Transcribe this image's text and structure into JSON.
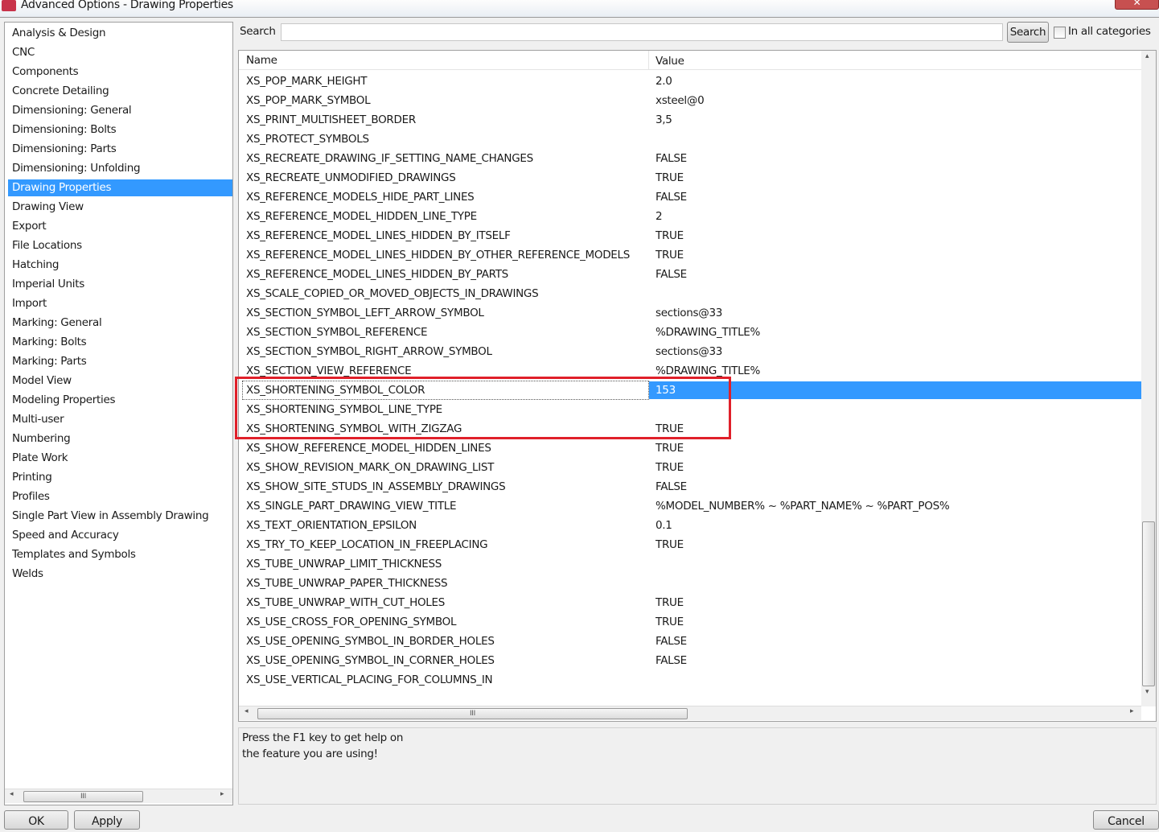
{
  "window": {
    "title": "Advanced Options - Drawing Properties",
    "close": "✕"
  },
  "categories": [
    "Analysis & Design",
    "CNC",
    "Components",
    "Concrete Detailing",
    "Dimensioning: General",
    "Dimensioning: Bolts",
    "Dimensioning: Parts",
    "Dimensioning: Unfolding",
    "Drawing Properties",
    "Drawing View",
    "Export",
    "File Locations",
    "Hatching",
    "Imperial Units",
    "Import",
    "Marking: General",
    "Marking: Bolts",
    "Marking: Parts",
    "Model View",
    "Modeling Properties",
    "Multi-user",
    "Numbering",
    "Plate Work",
    "Printing",
    "Profiles",
    "Single Part View in Assembly Drawing",
    "Speed and Accuracy",
    "Templates and Symbols",
    "Welds"
  ],
  "selected_category": "Drawing Properties",
  "search": {
    "label": "Search",
    "value": "",
    "button": "Search",
    "all_categories_label": "In all categories",
    "all_categories_checked": false
  },
  "table": {
    "headers": {
      "name": "Name",
      "value": "Value"
    },
    "selected_row": "XS_SHORTENING_SYMBOL_COLOR",
    "rows": [
      {
        "name": "XS_POP_MARK_HEIGHT",
        "value": "2.0"
      },
      {
        "name": "XS_POP_MARK_SYMBOL",
        "value": "xsteel@0"
      },
      {
        "name": "XS_PRINT_MULTISHEET_BORDER",
        "value": "3,5"
      },
      {
        "name": "XS_PROTECT_SYMBOLS",
        "value": ""
      },
      {
        "name": "XS_RECREATE_DRAWING_IF_SETTING_NAME_CHANGES",
        "value": "FALSE"
      },
      {
        "name": "XS_RECREATE_UNMODIFIED_DRAWINGS",
        "value": "TRUE"
      },
      {
        "name": "XS_REFERENCE_MODELS_HIDE_PART_LINES",
        "value": "FALSE"
      },
      {
        "name": "XS_REFERENCE_MODEL_HIDDEN_LINE_TYPE",
        "value": "2"
      },
      {
        "name": "XS_REFERENCE_MODEL_LINES_HIDDEN_BY_ITSELF",
        "value": "TRUE"
      },
      {
        "name": "XS_REFERENCE_MODEL_LINES_HIDDEN_BY_OTHER_REFERENCE_MODELS",
        "value": "TRUE"
      },
      {
        "name": "XS_REFERENCE_MODEL_LINES_HIDDEN_BY_PARTS",
        "value": "FALSE"
      },
      {
        "name": "XS_SCALE_COPIED_OR_MOVED_OBJECTS_IN_DRAWINGS",
        "value": ""
      },
      {
        "name": "XS_SECTION_SYMBOL_LEFT_ARROW_SYMBOL",
        "value": "sections@33"
      },
      {
        "name": "XS_SECTION_SYMBOL_REFERENCE",
        "value": "%DRAWING_TITLE%"
      },
      {
        "name": "XS_SECTION_SYMBOL_RIGHT_ARROW_SYMBOL",
        "value": "sections@33"
      },
      {
        "name": "XS_SECTION_VIEW_REFERENCE",
        "value": "%DRAWING_TITLE%"
      },
      {
        "name": "XS_SHORTENING_SYMBOL_COLOR",
        "value": "153"
      },
      {
        "name": "XS_SHORTENING_SYMBOL_LINE_TYPE",
        "value": ""
      },
      {
        "name": "XS_SHORTENING_SYMBOL_WITH_ZIGZAG",
        "value": "TRUE"
      },
      {
        "name": "XS_SHOW_REFERENCE_MODEL_HIDDEN_LINES",
        "value": "TRUE"
      },
      {
        "name": "XS_SHOW_REVISION_MARK_ON_DRAWING_LIST",
        "value": "TRUE"
      },
      {
        "name": "XS_SHOW_SITE_STUDS_IN_ASSEMBLY_DRAWINGS",
        "value": "FALSE"
      },
      {
        "name": "XS_SINGLE_PART_DRAWING_VIEW_TITLE",
        "value": " %MODEL_NUMBER% ~ %PART_NAME% ~ %PART_POS%"
      },
      {
        "name": "XS_TEXT_ORIENTATION_EPSILON",
        "value": "0.1"
      },
      {
        "name": "XS_TRY_TO_KEEP_LOCATION_IN_FREEPLACING",
        "value": "TRUE"
      },
      {
        "name": "XS_TUBE_UNWRAP_LIMIT_THICKNESS",
        "value": ""
      },
      {
        "name": "XS_TUBE_UNWRAP_PAPER_THICKNESS",
        "value": ""
      },
      {
        "name": "XS_TUBE_UNWRAP_WITH_CUT_HOLES",
        "value": "TRUE"
      },
      {
        "name": "XS_USE_CROSS_FOR_OPENING_SYMBOL",
        "value": "TRUE"
      },
      {
        "name": "XS_USE_OPENING_SYMBOL_IN_BORDER_HOLES",
        "value": "FALSE"
      },
      {
        "name": "XS_USE_OPENING_SYMBOL_IN_CORNER_HOLES",
        "value": "FALSE"
      },
      {
        "name": "XS_USE_VERTICAL_PLACING_FOR_COLUMNS_IN",
        "value": ""
      }
    ]
  },
  "help_text": {
    "line1": "Press the F1 key to get help on",
    "line2": "the feature you are using!"
  },
  "buttons": {
    "ok": "OK",
    "apply": "Apply",
    "cancel": "Cancel"
  },
  "scroll_glyphs": {
    "left": "◂",
    "right": "▸",
    "up": "▴",
    "down": "▾",
    "grip": "III"
  },
  "colors": {
    "selection": "#3399ff",
    "highlight_box": "#e0202a"
  }
}
